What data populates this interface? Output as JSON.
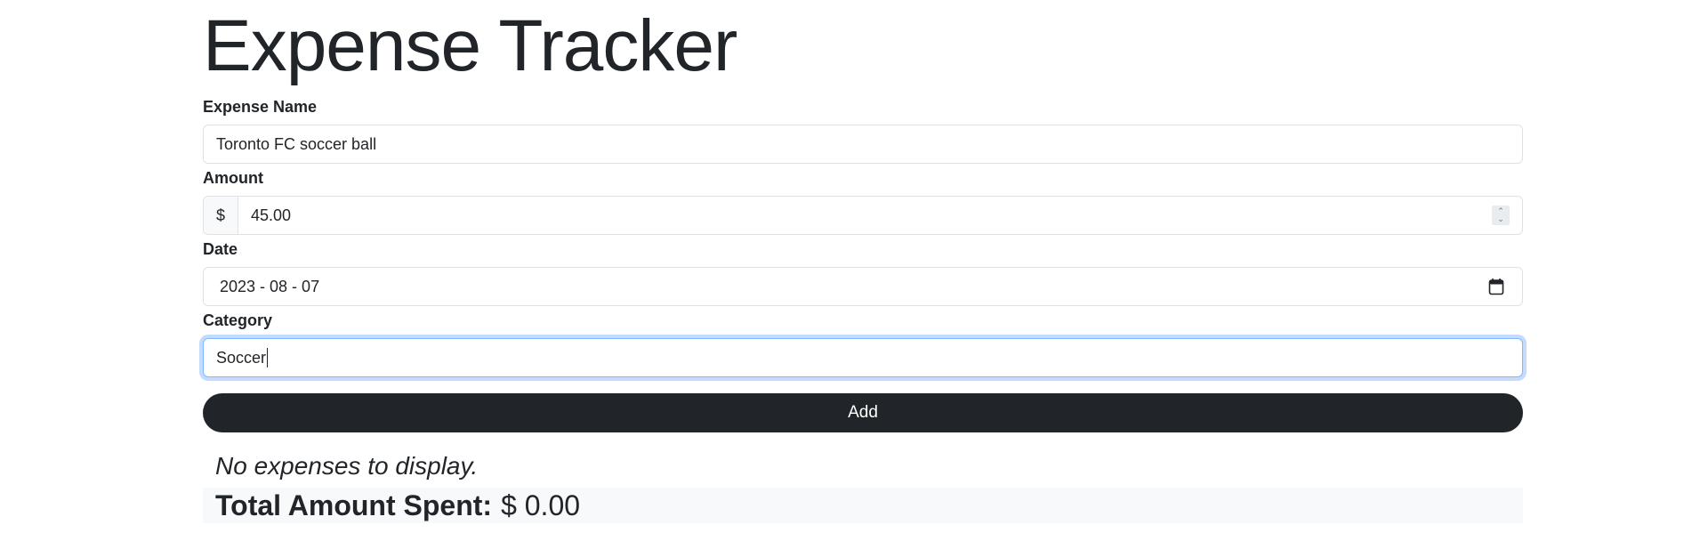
{
  "page": {
    "title": "Expense Tracker"
  },
  "form": {
    "expense_name": {
      "label": "Expense Name",
      "value": "Toronto FC soccer ball"
    },
    "amount": {
      "label": "Amount",
      "prefix": "$",
      "value": "45.00"
    },
    "date": {
      "label": "Date",
      "value": "2023 - 08 - 07"
    },
    "category": {
      "label": "Category",
      "value": "Soccer"
    },
    "add_button_label": "Add"
  },
  "expenses": {
    "empty_message": "No expenses to display."
  },
  "summary": {
    "total_label": "Total Amount Spent:",
    "total_value": "$ 0.00"
  },
  "colors": {
    "button_bg": "#212529",
    "focus_border": "#86b7fe",
    "summary_bg": "#f8f9fa"
  },
  "icons": {
    "date_picker": "calendar-icon",
    "amount_stepper": "spinner-icon"
  }
}
